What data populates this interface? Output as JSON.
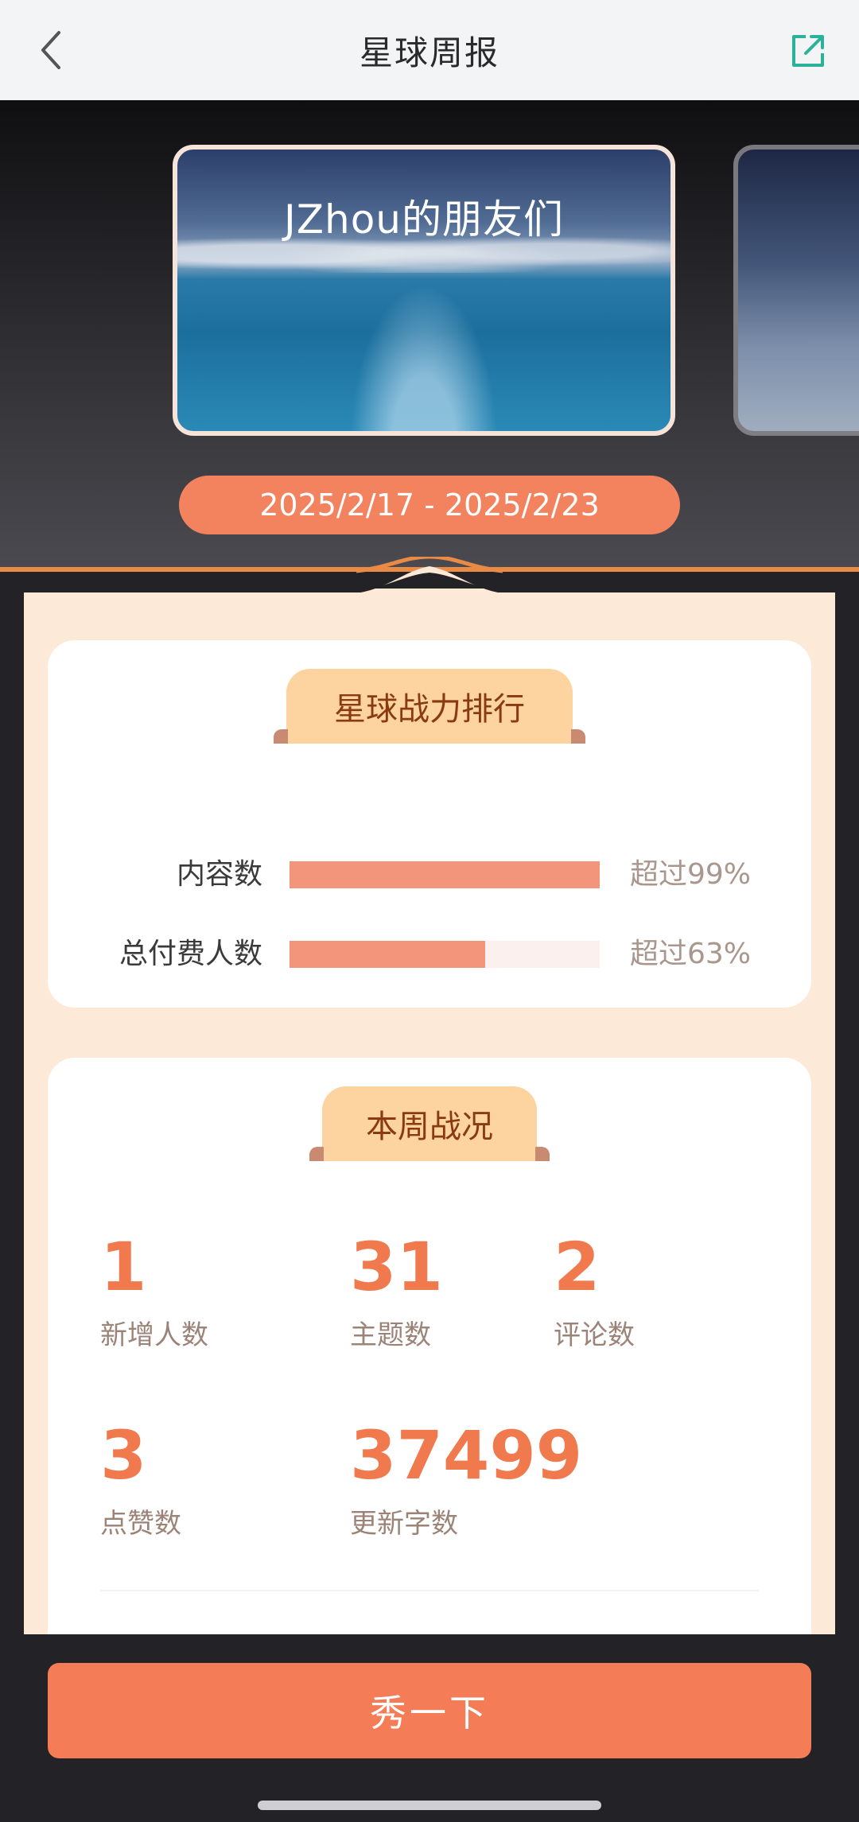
{
  "header": {
    "title": "星球周报",
    "back_icon": "chevron-left-icon",
    "share_icon": "external-share-icon"
  },
  "hero": {
    "card_title": "JZhou的朋友们",
    "date_range": "2025/2/17 - 2025/2/23"
  },
  "rank": {
    "heading": "星球战力排行",
    "rows": [
      {
        "label": "内容数",
        "percent_text": "超过99%",
        "fill": 1.0
      },
      {
        "label": "总付费人数",
        "percent_text": "超过63%",
        "fill": 0.63
      }
    ]
  },
  "stats": {
    "heading": "本周战况",
    "items": [
      {
        "value": "1",
        "label": "新增人数"
      },
      {
        "value": "31",
        "label": "主题数"
      },
      {
        "value": "2",
        "label": "评论数"
      },
      {
        "value": "3",
        "label": "点赞数"
      },
      {
        "value": "37499",
        "label": "更新字数"
      }
    ]
  },
  "cta": {
    "label": "秀一下"
  },
  "colors": {
    "accent": "#f47c57",
    "tab": "#fdd3a0",
    "bar": "#f3957a",
    "peach_bg": "#fde9d7"
  }
}
